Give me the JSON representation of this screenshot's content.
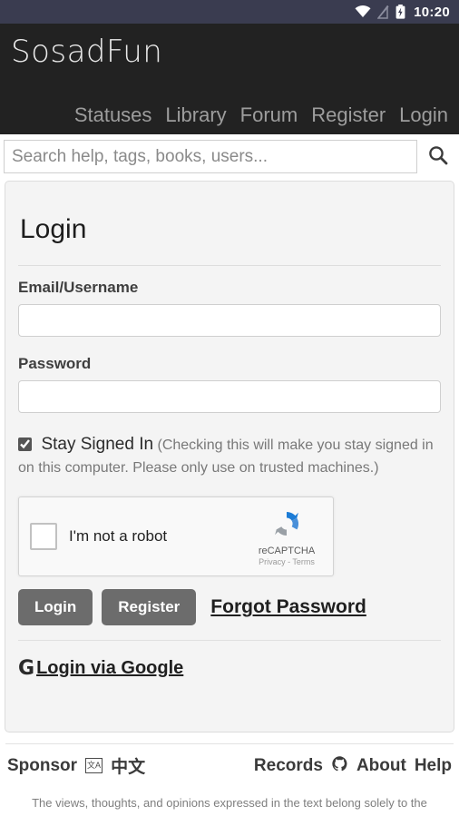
{
  "statusbar": {
    "wifi_icon": "wifi-icon",
    "signal_off_icon": "signal-off-icon",
    "battery_icon": "battery-charging-icon",
    "time": "10:20"
  },
  "header": {
    "brand": "SosadFun",
    "nav": [
      {
        "label": "Statuses"
      },
      {
        "label": "Library"
      },
      {
        "label": "Forum"
      },
      {
        "label": "Register"
      },
      {
        "label": "Login"
      }
    ]
  },
  "search": {
    "placeholder": "Search help, tags, books, users...",
    "value": "",
    "icon": "search-icon"
  },
  "login_card": {
    "title": "Login",
    "email_label": "Email/Username",
    "email_value": "",
    "password_label": "Password",
    "password_value": "",
    "stay_signed_in": {
      "label": "Stay Signed In",
      "hint": "(Checking this will make you stay signed in on this computer. Please only use on trusted machines.)",
      "checked": true
    },
    "recaptcha": {
      "checkbox_label": "I'm not a robot",
      "brand": "reCAPTCHA",
      "links": "Privacy - Terms",
      "logo_icon": "recaptcha-logo-icon",
      "checked": false
    },
    "login_button": "Login",
    "register_button": "Register",
    "forgot_password": "Forgot Password",
    "google_login": "Login via Google",
    "google_icon": "google-g-icon"
  },
  "footer": {
    "sponsor": "Sponsor",
    "lang_icon": "language-translate-icon",
    "lang_label": "中文",
    "records": "Records",
    "github_icon": "github-icon",
    "about": "About",
    "help": "Help",
    "disclaimer": "The views, thoughts, and opinions expressed in the text belong solely to the"
  },
  "colors": {
    "statusbar_bg": "#3a3c50",
    "header_bg": "#222222",
    "card_bg": "#f4f4f4",
    "button_bg": "#6c6c6c"
  }
}
